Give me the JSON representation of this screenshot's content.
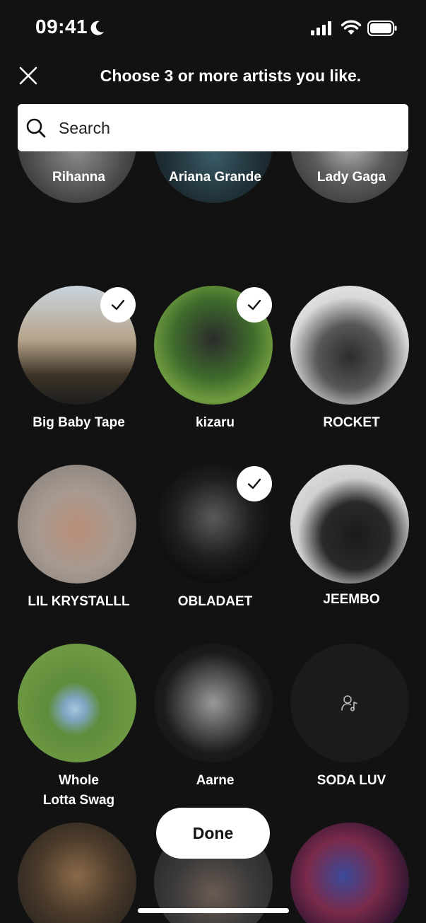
{
  "status": {
    "time": "09:41"
  },
  "header": {
    "title": "Choose 3 or more artists you like."
  },
  "search": {
    "placeholder": "Search"
  },
  "artists": [
    {
      "name": "Rihanna",
      "selected": false
    },
    {
      "name": "Ariana Grande",
      "selected": false
    },
    {
      "name": "Lady Gaga",
      "selected": false
    },
    {
      "name": "Big Baby Tape",
      "selected": true
    },
    {
      "name": "kizaru",
      "selected": true
    },
    {
      "name": "ROCKET",
      "selected": false
    },
    {
      "name": "LIL KRYSTALLL",
      "selected": false
    },
    {
      "name": "OBLADAET",
      "selected": true
    },
    {
      "name": "JEEMBO",
      "selected": false
    },
    {
      "name": "Whole\nLotta Swag",
      "line1": "Whole",
      "line2": "Lotta Swag",
      "selected": false
    },
    {
      "name": "Aarne",
      "selected": false
    },
    {
      "name": "SODA LUV",
      "selected": false,
      "placeholder_icon": "user-music-icon"
    }
  ],
  "done_label": "Done",
  "colors": {
    "background": "#121212",
    "text": "#ffffff",
    "button": "#ffffff"
  }
}
